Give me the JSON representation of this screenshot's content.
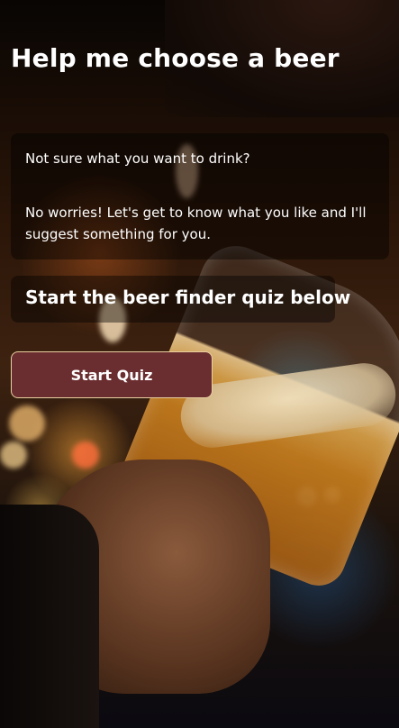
{
  "page": {
    "title": "Help me choose a beer",
    "intro_line1": "Not sure what you want to drink?",
    "intro_line2": "No worries! Let's get to know what you like and I'll suggest something for you.",
    "subheading": "Start the beer finder quiz below",
    "start_button_label": "Start Quiz"
  },
  "colors": {
    "button_bg": "#6b2e30",
    "button_border": "#e9cfa0",
    "text": "#ffffff"
  }
}
